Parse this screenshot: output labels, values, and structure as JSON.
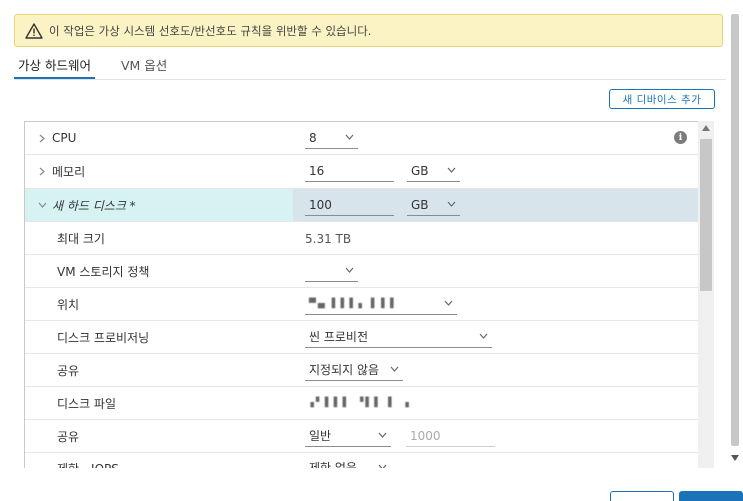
{
  "warning": {
    "text": "이 작업은 가상 시스템 선호도/반선호도 규칙을 위반할 수 있습니다."
  },
  "tabs": [
    {
      "label": "가상 하드웨어"
    },
    {
      "label": "VM 옵션"
    }
  ],
  "add_device_button": "새 디바이스 추가",
  "rows": {
    "cpu": {
      "label": "CPU",
      "value": "8"
    },
    "memory": {
      "label": "메모리",
      "value": "16",
      "unit": "GB"
    },
    "new_disk": {
      "label": "새 하드 디스크 *",
      "value": "100",
      "unit": "GB"
    },
    "max_size": {
      "label": "최대 크기",
      "value": "5.31 TB"
    },
    "vm_storage_policy": {
      "label": "VM 스토리지 정책",
      "value": ""
    },
    "location": {
      "label": "위치",
      "value": "▀▄  ▌▌▌▖▐  ▌▌"
    },
    "disk_provisioning": {
      "label": "디스크 프로비저닝",
      "value": "씬 프로비전"
    },
    "sharing": {
      "label": "공유",
      "value": "지정되지 않음"
    },
    "disk_file": {
      "label": "디스크 파일",
      "value": "▗▘▌▌▌ ▝▌▌ ▌ ▗"
    },
    "shares": {
      "label": "공유",
      "value": "일반",
      "amount": "1000"
    },
    "limit_iops": {
      "label": "제한 - IOPS",
      "value": "제한 없음"
    }
  },
  "colors": {
    "accent": "#1a73b8",
    "warning_bg": "#fcf3c4",
    "highlight": "#d8e4ec"
  }
}
